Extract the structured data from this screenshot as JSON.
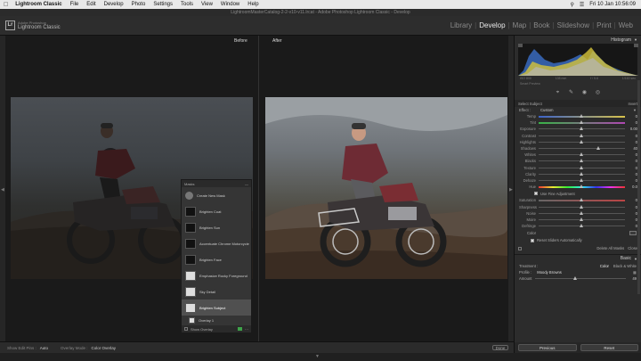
{
  "menubar": {
    "app": "Lightroom Classic",
    "items": [
      "File",
      "Edit",
      "Develop",
      "Photo",
      "Settings",
      "Tools",
      "View",
      "Window",
      "Help"
    ],
    "clock": "Fri 10 Jan  10:56:09"
  },
  "window": {
    "title": "LightroomMasterCatalog-2-2-v10-v11.lrcat - Adobe Photoshop Lightroom Classic - Develop",
    "identity_top": "Adobe Photoshop",
    "identity_bottom": "Lightroom Classic",
    "logo": "Lr"
  },
  "modules": [
    {
      "label": "Library",
      "active": false
    },
    {
      "label": "Develop",
      "active": true
    },
    {
      "label": "Map",
      "active": false
    },
    {
      "label": "Book",
      "active": false
    },
    {
      "label": "Slideshow",
      "active": false
    },
    {
      "label": "Print",
      "active": false
    },
    {
      "label": "Web",
      "active": false
    }
  ],
  "view": {
    "before_label": "Before",
    "after_label": "After"
  },
  "masks_panel": {
    "title": "Masks",
    "rows": [
      {
        "label": "Create New Mask",
        "type": "new"
      },
      {
        "label": "Brighten Coat",
        "type": "mask"
      },
      {
        "label": "Brighten Sun",
        "type": "mask"
      },
      {
        "label": "Accentuate Chrome Motorcycle",
        "type": "mask"
      },
      {
        "label": "Brighten Face",
        "type": "mask"
      },
      {
        "label": "Emphasize Rocky Foreground",
        "type": "mask"
      },
      {
        "label": "Sky Detail",
        "type": "mask"
      },
      {
        "label": "Brighten Subject",
        "type": "mask",
        "selected": true
      }
    ],
    "sub_label": "Overlay 1",
    "add_label": "Add",
    "subtract_label": "Subtract",
    "show_overlay": "Show Overlay"
  },
  "toolbar": {
    "pins_label": "Show Edit Pins :",
    "pins_value": "Auto",
    "overlay_label": "Overlay Mode :",
    "overlay_value": "Color Overlay",
    "done": "Done"
  },
  "right_panel": {
    "histogram_title": "Histogram",
    "histo_info": [
      "ISO 800",
      "135 mm",
      "f / 5.6",
      "1/160 sec"
    ],
    "smart_preview": "Smart Preview",
    "subject_title": "Select Subject",
    "invert": "Invert",
    "effect_label": "Effect :",
    "effect_value": "Custom",
    "sliders": [
      {
        "label": "Temp",
        "value": "0",
        "pos": 0.5,
        "style": "temp"
      },
      {
        "label": "Tint",
        "value": "0",
        "pos": 0.5,
        "style": "tint"
      },
      {
        "label": "Exposure",
        "value": "0.00",
        "pos": 0.5
      },
      {
        "label": "Contrast",
        "value": "0",
        "pos": 0.5
      },
      {
        "label": "Highlights",
        "value": "0",
        "pos": 0.5
      },
      {
        "label": "Shadows",
        "value": "40",
        "pos": 0.7
      },
      {
        "label": "Whites",
        "value": "0",
        "pos": 0.5
      },
      {
        "label": "Blacks",
        "value": "0",
        "pos": 0.5
      },
      {
        "label": "Texture",
        "value": "0",
        "pos": 0.5
      },
      {
        "label": "Clarity",
        "value": "0",
        "pos": 0.5
      },
      {
        "label": "Dehaze",
        "value": "0",
        "pos": 0.5
      },
      {
        "label": "Hue",
        "value": "0.0",
        "pos": 0.5,
        "style": "hue"
      }
    ],
    "fine_adjust": "Use Fine Adjustment",
    "sliders2": [
      {
        "label": "Saturation",
        "value": "0",
        "pos": 0.5,
        "style": "sat"
      },
      {
        "label": "Sharpness",
        "value": "0",
        "pos": 0.5
      },
      {
        "label": "Noise",
        "value": "0",
        "pos": 0.5
      },
      {
        "label": "Moire",
        "value": "0",
        "pos": 0.5
      },
      {
        "label": "Defringe",
        "value": "0",
        "pos": 0.5
      }
    ],
    "color_label": "Color",
    "reset_sliders": "Reset Sliders Automatically",
    "delete_all": "Delete All Masks",
    "close": "Close",
    "basic_title": "Basic",
    "treatment_label": "Treatment :",
    "treatment_color": "Color",
    "treatment_bw": "Black & White",
    "profile_label": "Profile :",
    "profile_value": "Moody Browns",
    "amount_label": "Amount",
    "amount_value": "49",
    "amount_pos": 0.45,
    "previous": "Previous",
    "reset": "Reset"
  }
}
